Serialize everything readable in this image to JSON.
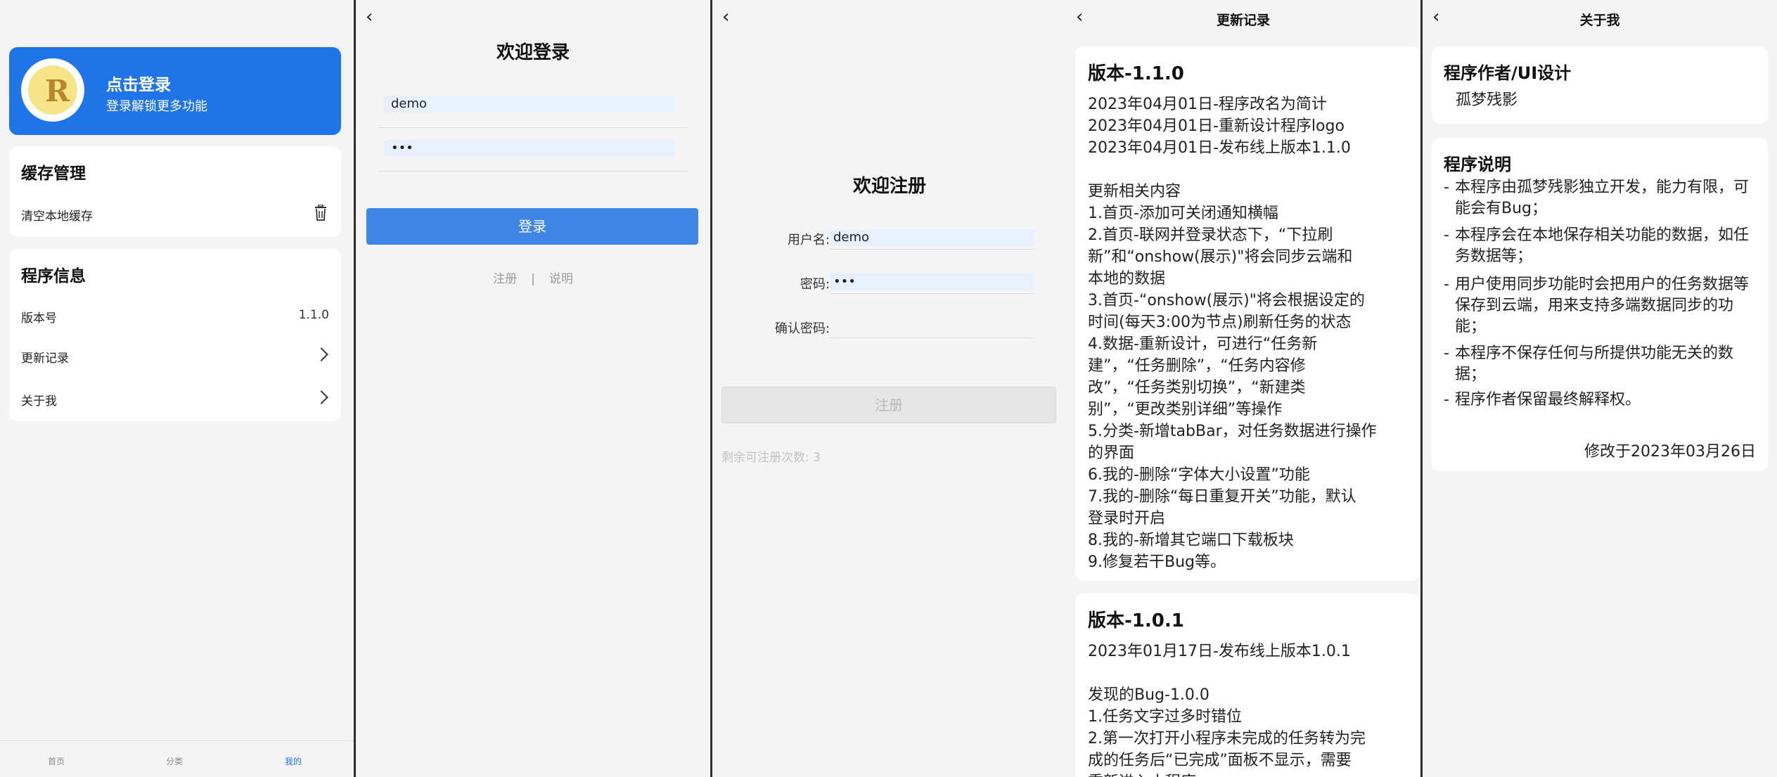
{
  "profile": {
    "login_title": "点击登录",
    "login_sub": "登录解锁更多功能",
    "avatar_letter": "R",
    "cache": {
      "title": "缓存管理",
      "clear": "清空本地缓存"
    },
    "info": {
      "title": "程序信息",
      "version_label": "版本号",
      "version_value": "1.1.0",
      "changelog": "更新记录",
      "about": "关于我"
    },
    "tabs": [
      "首页",
      "分类",
      "我的"
    ]
  },
  "login": {
    "title": "欢迎登录",
    "username": "demo",
    "password": "•••",
    "button": "登录",
    "register": "注册",
    "sep": "|",
    "help": "说明"
  },
  "register": {
    "title": "欢迎注册",
    "username_label": "用户名:",
    "username": "demo",
    "password_label": "密码:",
    "password": "•••",
    "confirm_label": "确认密码:",
    "button": "注册",
    "remain": "剩余可注册次数: 3"
  },
  "changelog": {
    "title": "更新记录",
    "v110": {
      "heading": "版本-1.1.0",
      "lines": [
        "2023年04月01日-程序改名为简计",
        "2023年04月01日-重新设计程序logo",
        "2023年04月01日-发布线上版本1.1.0",
        "",
        "更新相关内容",
        "1.首页-添加可关闭通知横幅",
        "2.首页-联网并登录状态下，“下拉刷",
        "新”和“onshow(展示)\"将会同步云端和",
        "本地的数据",
        "3.首页-“onshow(展示)\"将会根据设定的",
        "时间(每天3:00为节点)刷新任务的状态",
        "4.数据-重新设计，可进行“任务新",
        "建”，“任务删除”，“任务内容修",
        "改”，“任务类别切换”，“新建类",
        "别”，“更改类别详细”等操作",
        "5.分类-新增tabBar，对任务数据进行操作",
        "的界面",
        "6.我的-删除“字体大小设置”功能",
        "7.我的-删除“每日重复开关”功能，默认",
        "登录时开启",
        "8.我的-新增其它端口下载板块",
        "9.修复若干Bug等。"
      ]
    },
    "v101": {
      "heading": "版本-1.0.1",
      "lines": [
        "2023年01月17日-发布线上版本1.0.1",
        "",
        "发现的Bug-1.0.0",
        "1.任务文字过多时错位",
        "2.第一次打开小程序未完成的任务转为完",
        "成的任务后“已完成”面板不显示，需要",
        "重新进入小程序"
      ]
    }
  },
  "about": {
    "title": "关于我",
    "author_h": "程序作者/UI设计",
    "author": "孤梦残影",
    "desc_h": "程序说明",
    "bullets": [
      "本程序由孤梦残影独立开发，能力有限，可能会有Bug；",
      "本程序会在本地保存相关功能的数据，如任务数据等；",
      "用户使用同步功能时会把用户的任务数据等保存到云端，用来支持多端数据同步的功能；",
      "本程序不保存任何与所提供功能无关的数据；",
      "程序作者保留最终解释权。"
    ],
    "modified": "修改于2023年03月26日"
  },
  "colors": {
    "accent": "#1f75e8",
    "button": "#3d86e6",
    "bg": "#f4f4f5"
  }
}
